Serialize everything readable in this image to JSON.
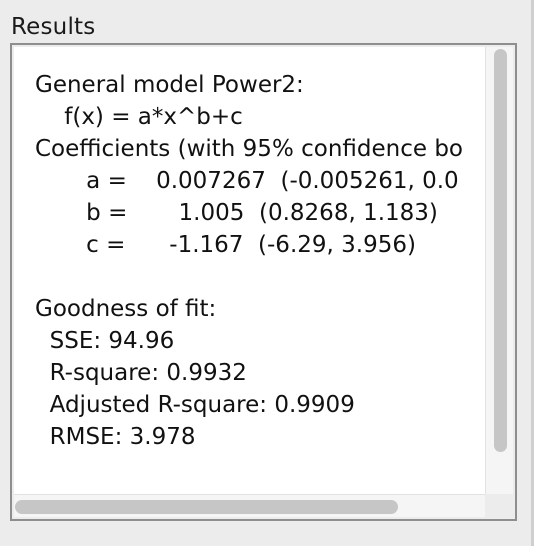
{
  "panel": {
    "title": "Results"
  },
  "results": {
    "text": "General model Power2:\n    f(x) = a*x^b+c\nCoefficients (with 95% confidence bo\n       a =    0.007267  (-0.005261, 0.0\n       b =       1.005  (0.8268, 1.183)\n       c =      -1.167  (-6.29, 3.956)\n\nGoodness of fit:\n  SSE: 94.96\n  R-square: 0.9932\n  Adjusted R-square: 0.9909\n  RMSE: 3.978"
  },
  "scrollbars": {
    "vertical": "vertical-scrollbar",
    "horizontal": "horizontal-scrollbar"
  },
  "colors": {
    "panel_bg": "#ececec",
    "text_area_bg": "#ffffff",
    "border": "#8e8e8e",
    "scroll_thumb": "#c6c6c6"
  }
}
